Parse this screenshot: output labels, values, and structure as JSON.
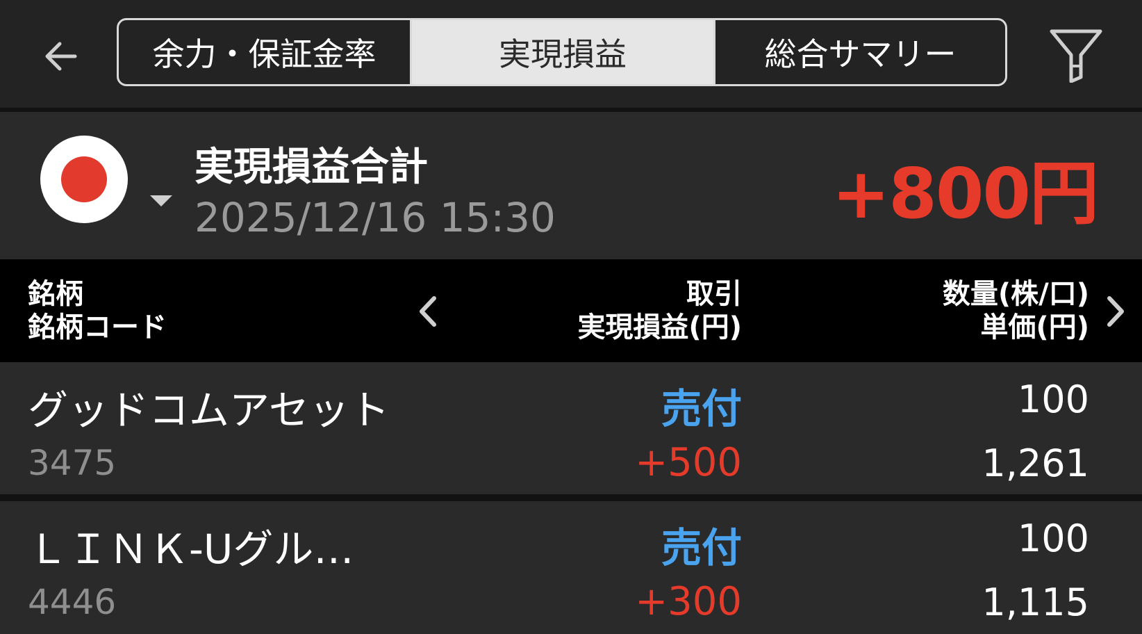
{
  "header": {
    "tabs": [
      {
        "label": "余力・保証金率"
      },
      {
        "label": "実現損益"
      },
      {
        "label": "総合サマリー"
      }
    ],
    "back_icon": "arrow-left-icon",
    "filter_icon": "filter-icon"
  },
  "summary": {
    "market_flag": "japan-flag-icon",
    "title": "実現損益合計",
    "datetime": "2025/12/16  15:30",
    "total": "+800円"
  },
  "columns": {
    "left_line1": "銘柄",
    "left_line2": "銘柄コード",
    "mid_line1": "取引",
    "mid_line2": "実現損益(円)",
    "right_line1": "数量(株/口)",
    "right_line2": "単価(円)"
  },
  "rows": [
    {
      "name": "グッドコムアセット",
      "code": "3475",
      "trade": "売付",
      "pnl": "+500",
      "qty": "100",
      "price": "1,261"
    },
    {
      "name": "ＬＩＮＫ-Uグル…",
      "code": "4446",
      "trade": "売付",
      "pnl": "+300",
      "qty": "100",
      "price": "1,115"
    }
  ],
  "colors": {
    "positive": "#e63a2b",
    "trade_sell": "#4aa3ef"
  }
}
